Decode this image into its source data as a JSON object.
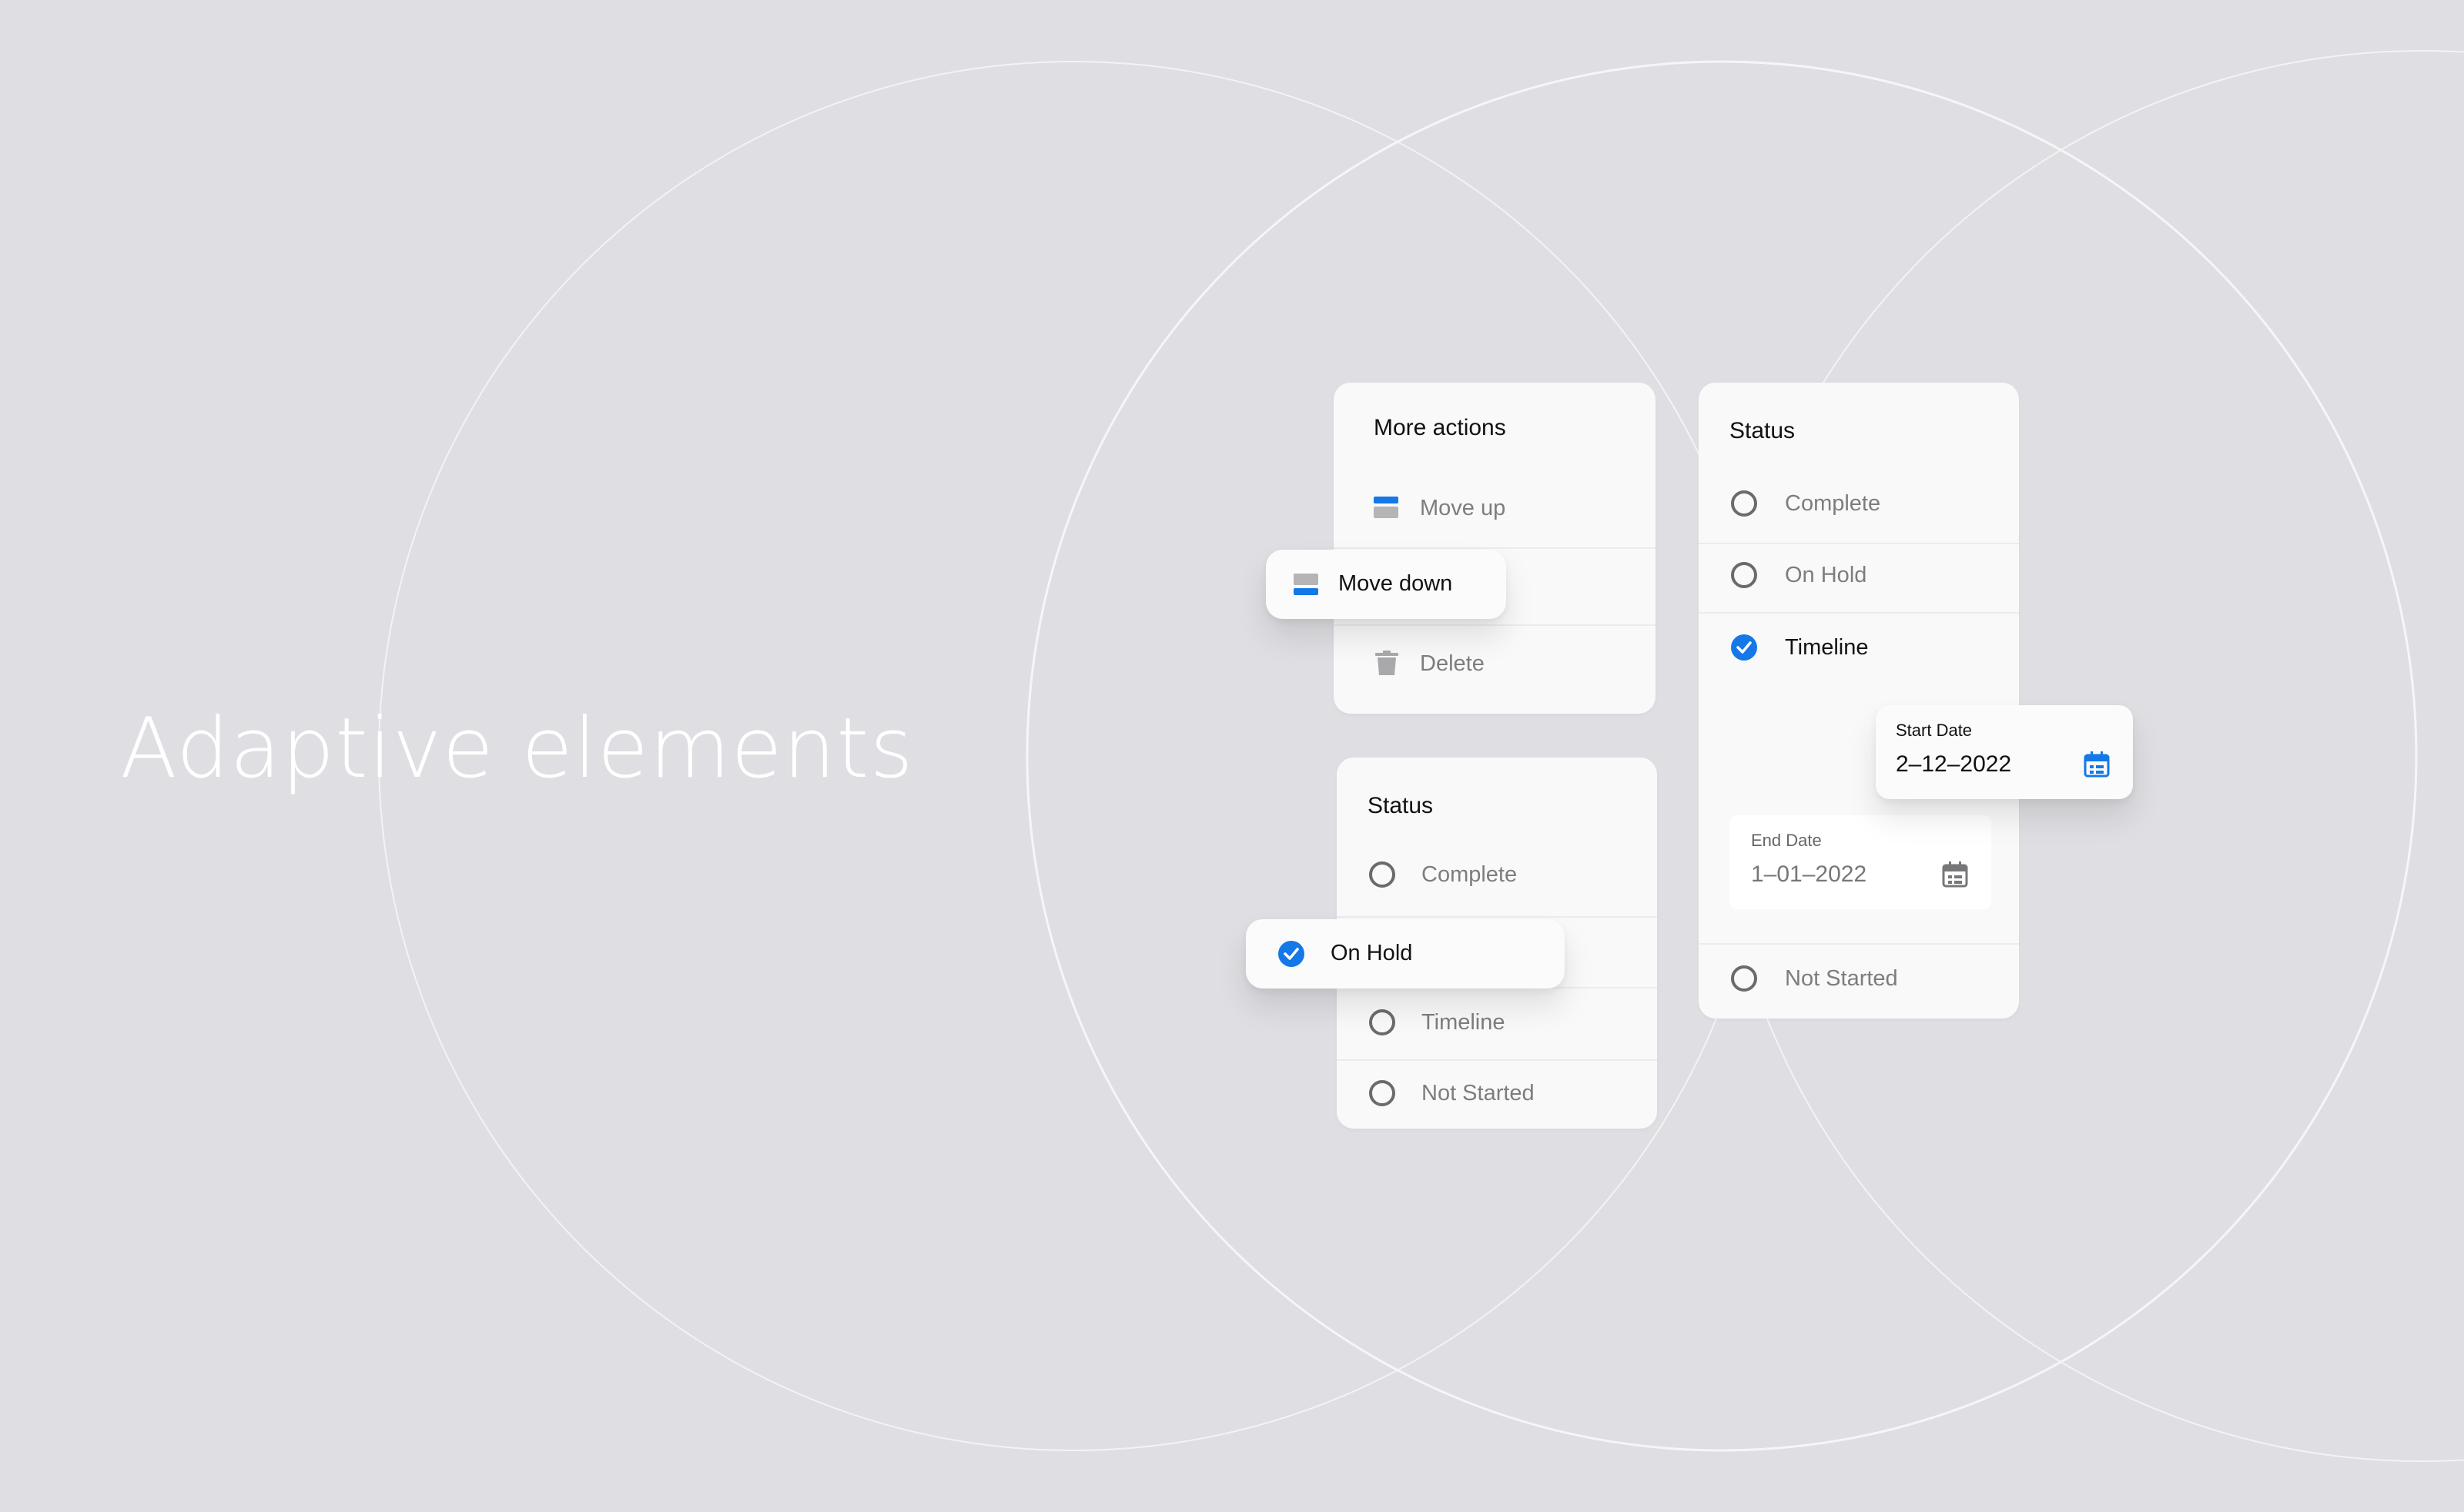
{
  "headline": "Adaptive elements",
  "more_actions": {
    "title": "More actions",
    "items": [
      {
        "label": "Move up",
        "icon": "move-up-icon"
      },
      {
        "label": "Move down",
        "icon": "move-down-icon"
      },
      {
        "label": "Delete",
        "icon": "trash-icon"
      }
    ]
  },
  "status_left": {
    "title": "Status",
    "options": [
      {
        "label": "Complete",
        "checked": false
      },
      {
        "label": "On Hold",
        "checked": true
      },
      {
        "label": "Timeline",
        "checked": false
      },
      {
        "label": "Not Started",
        "checked": false
      }
    ]
  },
  "status_right": {
    "title": "Status",
    "options": [
      {
        "label": "Complete",
        "checked": false
      },
      {
        "label": "On Hold",
        "checked": false
      },
      {
        "label": "Timeline",
        "checked": true
      },
      {
        "label": "Not Started",
        "checked": false
      }
    ],
    "start_date": {
      "label": "Start Date",
      "value": "2–12–2022",
      "icon": "calendar-icon"
    },
    "end_date": {
      "label": "End Date",
      "value": "1–01–2022",
      "icon": "calendar-icon"
    }
  },
  "colors": {
    "background": "#dfdee2",
    "accent": "#1478e8",
    "card": "#f9f9f9",
    "muted_text": "#7d7d80"
  }
}
